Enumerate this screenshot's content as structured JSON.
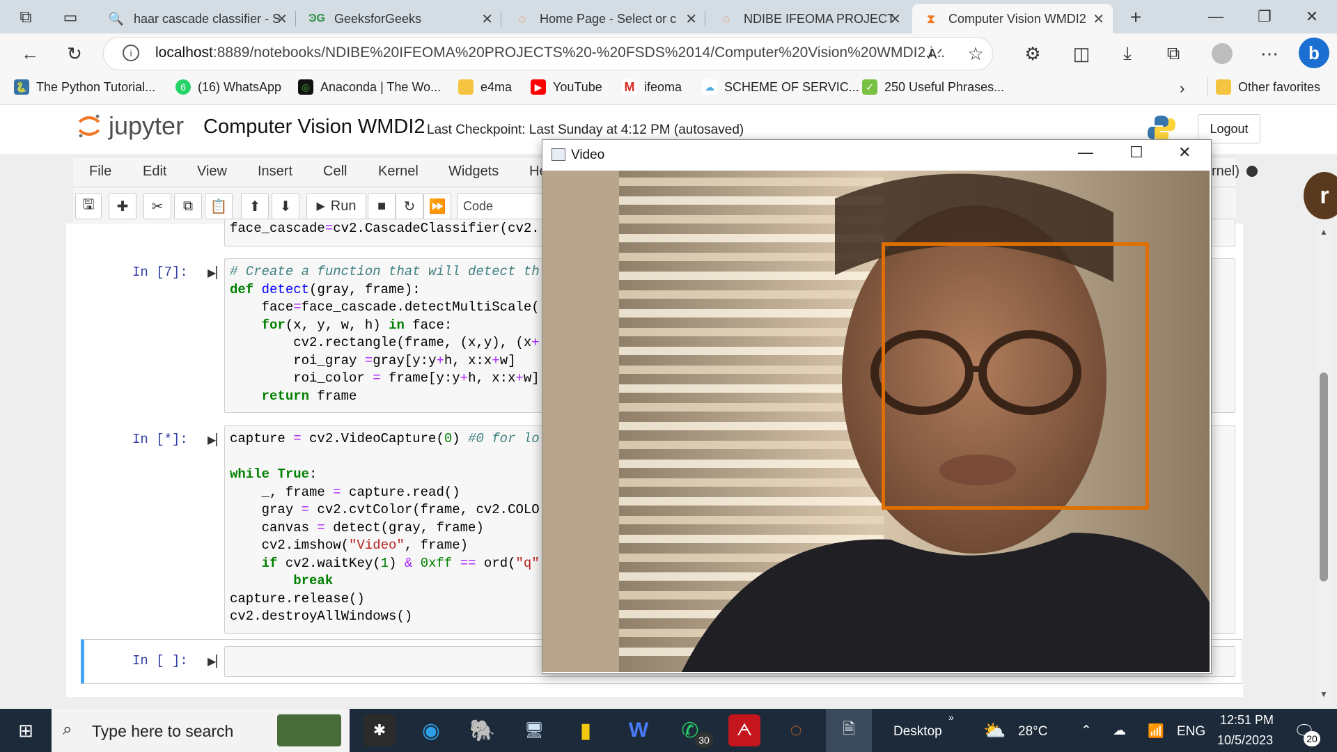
{
  "browser": {
    "tabs": [
      {
        "title": "haar cascade classifier - S",
        "icon": "search-icon"
      },
      {
        "title": "GeeksforGeeks",
        "icon": "geeksforgeeks-icon"
      },
      {
        "title": "Home Page - Select or c",
        "icon": "jupyter-icon"
      },
      {
        "title": "NDIBE IFEOMA PROJECT",
        "icon": "jupyter-icon"
      },
      {
        "title": "Computer Vision WMDI2",
        "icon": "hourglass-icon"
      }
    ],
    "new_tab": "+",
    "url_host": "localhost",
    "url_rest": ":8889/notebooks/NDIBE%20IFEOMA%20PROJECTS%20-%20FSDS%2014/Computer%20Vision%20WMDI2.i...",
    "bookmarks": [
      "The Python Tutorial...",
      "(16) WhatsApp",
      "Anaconda | The Wo...",
      "e4ma",
      "YouTube",
      "ifeoma",
      "SCHEME OF SERVIC...",
      "250 Useful Phrases..."
    ],
    "bookmarks_more": "Other favorites",
    "whatsapp_badge": "6"
  },
  "jupyter": {
    "logo_text": "jupyter",
    "notebook_title": "Computer Vision WMDI2",
    "checkpoint": "Last Checkpoint: Last Sunday at 4:12 PM  (autosaved)",
    "logout": "Logout",
    "menu": [
      "File",
      "Edit",
      "View",
      "Insert",
      "Cell",
      "Kernel",
      "Widgets",
      "He"
    ],
    "kernel_partial": "rnel)",
    "run_label": "Run",
    "cell_type": "Code",
    "cells": [
      {
        "prompt": "",
        "lines": [
          "face_cascade=cv2.CascadeClassifier(cv2."
        ]
      },
      {
        "prompt": "In [7]:",
        "lines": [
          "# Create a function that will detect th",
          "def detect(gray, frame):",
          "    face=face_cascade.detectMultiScale(",
          "    for(x, y, w, h) in face:",
          "        cv2.rectangle(frame, (x,y), (x+",
          "        roi_gray =gray[y:y+h, x:x+w]",
          "        roi_color = frame[y:y+h, x:x+w]",
          "    return frame"
        ]
      },
      {
        "prompt": "In [*]:",
        "lines": [
          "capture = cv2.VideoCapture(0) #0 for lo",
          "",
          "while True:",
          "    _, frame = capture.read()",
          "    gray = cv2.cvtColor(frame, cv2.COLO",
          "    canvas = detect(gray, frame)",
          "    cv2.imshow(\"Video\", frame)",
          "    if cv2.waitKey(1) & 0xff == ord(\"q\"",
          "        break",
          "capture.release()",
          "cv2.destroyAllWindows()"
        ]
      },
      {
        "prompt": "In [ ]:",
        "lines": [
          ""
        ]
      }
    ]
  },
  "video_window": {
    "title": "Video",
    "box_color": "#e06f00"
  },
  "taskbar": {
    "search_placeholder": "Type here to search",
    "desktop_label": "Desktop",
    "temperature": "28°C",
    "language": "ENG",
    "time": "12:51 PM",
    "date": "10/5/2023",
    "whatsapp_count": "30",
    "notification_count": "20"
  }
}
